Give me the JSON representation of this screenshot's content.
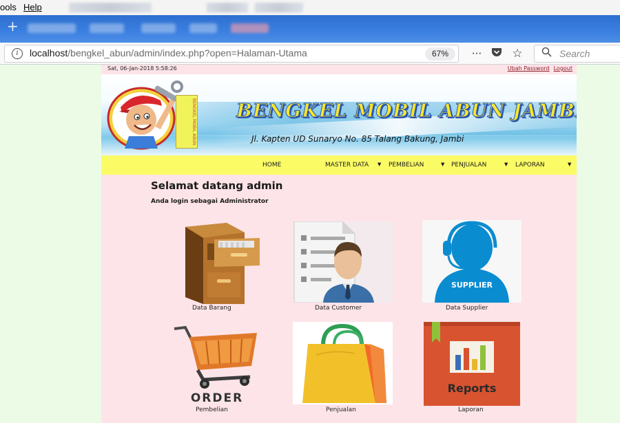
{
  "browser": {
    "menu": {
      "partial_item": "ools",
      "help": "Help"
    },
    "url": {
      "scheme_host": "localhost",
      "path": "/bengkel_abun/admin/index.php?open=Halaman-Utama"
    },
    "zoom": "67%",
    "search_placeholder": "Search",
    "icons": [
      "info-icon",
      "more-icon",
      "pocket-icon",
      "bookmark-star-icon",
      "search-icon"
    ]
  },
  "page": {
    "datetime": "Sat, 06-Jan-2018 5:58:26",
    "links": {
      "change_password": "Ubah Password",
      "logout": "Logout"
    },
    "banner": {
      "title": "BENGKEL MOBIL ABUN JAMBI",
      "address": "Jl. Kapten UD Sunaryo No. 85 Talang Bakung, Jambi",
      "logo_sign": "BENGKEL MOBIL ABUN"
    },
    "nav": {
      "home": "HOME",
      "master": "MASTER DATA",
      "pembelian": "PEMBELIAN",
      "penjualan": "PENJUALAN",
      "laporan": "LAPORAN"
    },
    "welcome": "Selamat datang admin",
    "role": "Anda login sebagai Administrator",
    "tiles": {
      "barang": "Data Barang",
      "customer": "Data Customer",
      "supplier": "Data Supplier",
      "supplier_caption": "SUPPLIER",
      "pembelian": "Pembelian",
      "order_caption": "ORDER",
      "penjualan": "Penjualan",
      "laporan": "Laporan",
      "reports_caption": "Reports"
    }
  },
  "colors": {
    "page_bg": "#fde4e8",
    "side_bg": "#ebfbe6",
    "nav_bg": "#fbfb66",
    "banner_title": "#f7e62a",
    "tab_bar": "#3b7fe0"
  }
}
